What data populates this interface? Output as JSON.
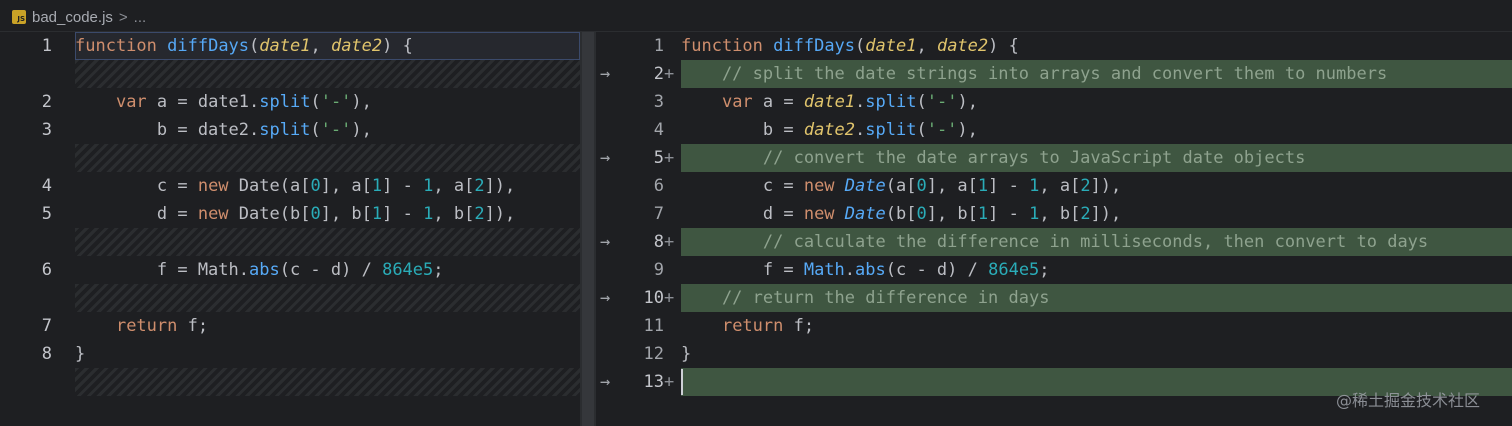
{
  "tab": {
    "file_name": "bad_code.js",
    "badge": "JS",
    "separator": ">",
    "more": "..."
  },
  "left": {
    "line_numbers": [
      "1",
      "2",
      "3",
      "4",
      "5",
      "6",
      "7",
      "8"
    ],
    "lines": [
      "function diffDays(date1, date2) {",
      "    var a = date1.split('-'),",
      "        b = date2.split('-'),",
      "        c = new Date(a[0], a[1] - 1, a[2]),",
      "        d = new Date(b[0], b[1] - 1, b[2]),",
      "        f = Math.abs(c - d) / 864e5;",
      "    return f;",
      "}"
    ]
  },
  "right": {
    "line_numbers": [
      "1",
      "2",
      "3",
      "4",
      "5",
      "6",
      "7",
      "8",
      "9",
      "10",
      "11",
      "12",
      "13"
    ],
    "added_marker": "+",
    "arrow": "→",
    "lines": [
      "function diffDays(date1, date2) {",
      "    // split the date strings into arrays and convert them to numbers",
      "    var a = date1.split('-'),",
      "        b = date2.split('-'),",
      "        // convert the date arrays to JavaScript date objects",
      "        c = new Date(a[0], a[1] - 1, a[2]),",
      "        d = new Date(b[0], b[1] - 1, b[2]),",
      "        // calculate the difference in milliseconds, then convert to days",
      "        f = Math.abs(c - d) / 864e5;",
      "    // return the difference in days",
      "    return f;",
      "}",
      ""
    ]
  },
  "colors": {
    "added_bg": "#3f5641",
    "keyword": "#cf8e6d",
    "string": "#6aab73",
    "number": "#2aacb8",
    "param": "#e0c46c"
  },
  "watermark": "@稀土掘金技术社区"
}
